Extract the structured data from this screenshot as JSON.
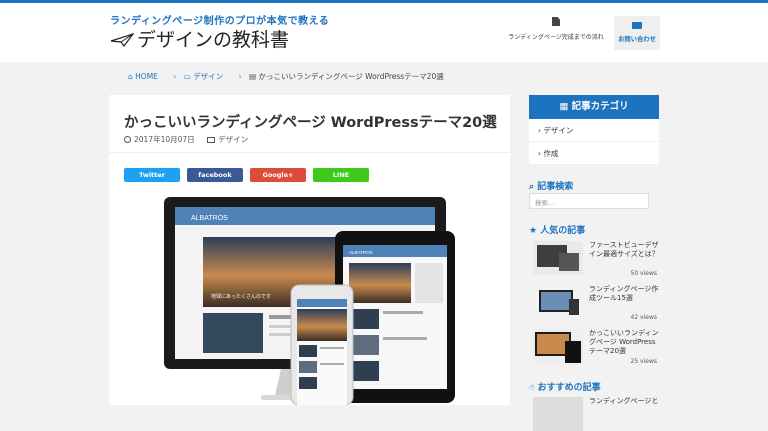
{
  "header": {
    "tagline": "ランディングページ制作のプロが本気で教える",
    "logo": "デザインの教科書",
    "nav": [
      {
        "label": "ランディングページ完成までの流れ"
      },
      {
        "label": "お問い合わせ"
      }
    ]
  },
  "breadcrumb": {
    "home": "HOME",
    "category": "デザイン",
    "current": "かっこいいランディングページ WordPressテーマ20選"
  },
  "article": {
    "title": "かっこいいランディングページ WordPressテーマ20選",
    "date": "2017年10月07日",
    "category": "デザイン",
    "share": [
      {
        "label": "Twitter",
        "color": "#1da1f2"
      },
      {
        "label": "facebook",
        "color": "#3b5998"
      },
      {
        "label": "Google+",
        "color": "#dd4b39"
      },
      {
        "label": "LINE",
        "color": "#3ec91c"
      }
    ],
    "mockup": {
      "brand": "ALBATROS",
      "hero_caption": "地球にあったくさんのです",
      "brand_small": "ALBATROS"
    }
  },
  "sidebar": {
    "category_head": "記事カテゴリ",
    "categories": [
      {
        "label": "デザイン"
      },
      {
        "label": "作成"
      }
    ],
    "search_head": "記事検索",
    "search_placeholder": "検索...",
    "popular_head": "人気の記事",
    "popular": [
      {
        "title": "ファーストビューデザイン最適サイズとは？",
        "views": "50 views"
      },
      {
        "title": "ランディングページ作成ツール15選",
        "views": "42 views"
      },
      {
        "title": "かっこいいランディングページ WordPressテーマ20選",
        "views": "25 views"
      }
    ],
    "recommend_head": "おすすめの記事",
    "recommend_first": "ランディングページと"
  },
  "colors": {
    "accent": "#1e73be",
    "background": "#f2f2f2"
  }
}
